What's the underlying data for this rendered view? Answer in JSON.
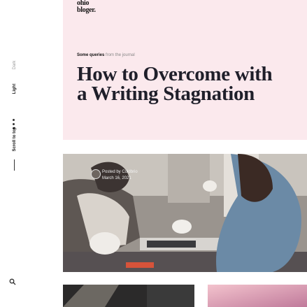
{
  "site": {
    "logo_line1": "ohio",
    "logo_line2": "bloger."
  },
  "sidebar": {
    "mode_dark": "Dark",
    "mode_light": "Light",
    "scroll_top": "Scroll to top",
    "search_icon": "search-icon"
  },
  "post": {
    "kicker_bold": "Some queries",
    "kicker_rest": "from the journal",
    "title": "How to Overcome with a Writing Stagnation",
    "author_line1": "Posted by Coldbrio",
    "author_line2": "March 16, 2021"
  },
  "colors": {
    "hero_bg": "#fbe9ed",
    "title": "#1f1f2a"
  }
}
